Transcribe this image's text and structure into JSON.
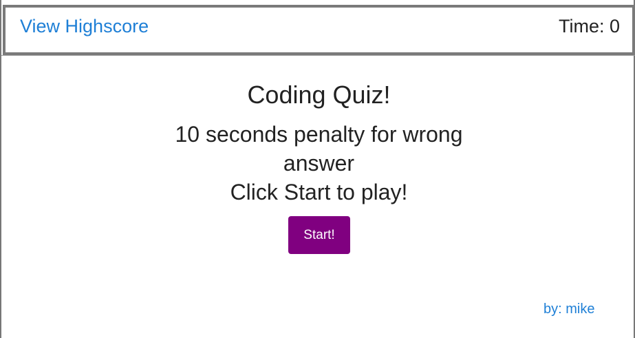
{
  "header": {
    "highscore_link": "View Highscore",
    "timer_label": "Time: 0"
  },
  "main": {
    "title": "Coding Quiz!",
    "penalty_text": "10 seconds penalty for wrong answer",
    "instruction_text": "Click Start to play!",
    "start_button": "Start!"
  },
  "footer": {
    "byline": "by: mike"
  },
  "colors": {
    "link": "#1e7fd6",
    "start_button_bg": "#800080",
    "border": "#7a7a7a"
  }
}
